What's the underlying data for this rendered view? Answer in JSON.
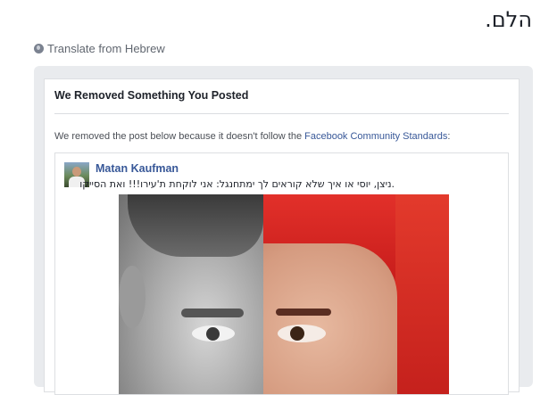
{
  "heading_text": "הלם.",
  "translate_link": "Translate from Hebrew",
  "notice": {
    "title": "We Removed Something You Posted",
    "body_prefix": "We removed the post below because it doesn't follow the ",
    "link_text": "Facebook Community Standards",
    "body_suffix": ":"
  },
  "post": {
    "author": "Matan Kaufman",
    "text": ".ניצן, יוסי או איך שלא קוראים לך ימתחנגל: אני לוקחת ת'עירו!!! ואת הסייקו"
  },
  "icons": {
    "translate": "globe-icon"
  }
}
